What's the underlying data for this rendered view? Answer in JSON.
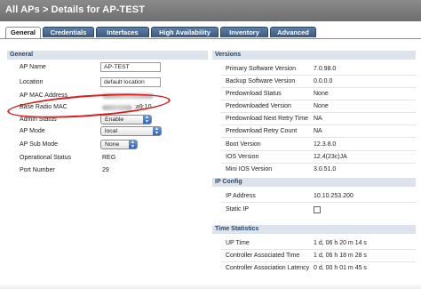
{
  "page": {
    "title": "All APs > Details for AP-TEST"
  },
  "tabs": [
    {
      "label": "General",
      "active": true
    },
    {
      "label": "Credentials"
    },
    {
      "label": "Interfaces"
    },
    {
      "label": "High Availability"
    },
    {
      "label": "Inventory"
    },
    {
      "label": "Advanced"
    }
  ],
  "general": {
    "title": "General",
    "rows": [
      {
        "label": "AP Name",
        "value": "AP-TEST"
      },
      {
        "label": "Location",
        "value": "default location"
      },
      {
        "label": "AP MAC Address",
        "value": ""
      },
      {
        "label": "Base Radio MAC",
        "value": ":a9:10"
      },
      {
        "label": "Admin Status",
        "value": "Enable"
      },
      {
        "label": "AP Mode",
        "value": "local"
      },
      {
        "label": "AP Sub Mode",
        "value": "None"
      },
      {
        "label": "Operational Status",
        "value": "REG"
      },
      {
        "label": "Port Number",
        "value": "29"
      }
    ]
  },
  "versions": {
    "title": "Versions",
    "rows": [
      {
        "label": "Primary Software Version",
        "value": "7.0.98.0"
      },
      {
        "label": "Backup Software Version",
        "value": "0.0.0.0"
      },
      {
        "label": "Predownload Status",
        "value": "None"
      },
      {
        "label": "Predownloaded Version",
        "value": "None"
      },
      {
        "label": "Predownload Next Retry Time",
        "value": "NA"
      },
      {
        "label": "Predownload Retry Count",
        "value": "NA"
      },
      {
        "label": "Boot Version",
        "value": "12.3.8.0"
      },
      {
        "label": "IOS Version",
        "value": "12.4(23c)JA"
      },
      {
        "label": "Mini IOS Version",
        "value": "3.0.51.0"
      }
    ]
  },
  "ip_config": {
    "title": "IP Config",
    "rows": [
      {
        "label": "IP Address",
        "value": "10.10.253.200"
      },
      {
        "label": "Static IP",
        "value": "",
        "checked": false
      }
    ]
  },
  "time_statistics": {
    "title": "Time Statistics",
    "rows": [
      {
        "label": "UP Time",
        "value": "1 d, 06 h 20 m 14 s"
      },
      {
        "label": "Controller Associated Time",
        "value": "1 d, 06 h 18 m 28 s"
      },
      {
        "label": "Controller Association Latency",
        "value": "0 d, 00 h 01 m 45 s"
      }
    ]
  },
  "colors": {
    "tab_bg": "#39597f",
    "section_bar": "#dde3ea",
    "highlight": "#d81e1e"
  }
}
